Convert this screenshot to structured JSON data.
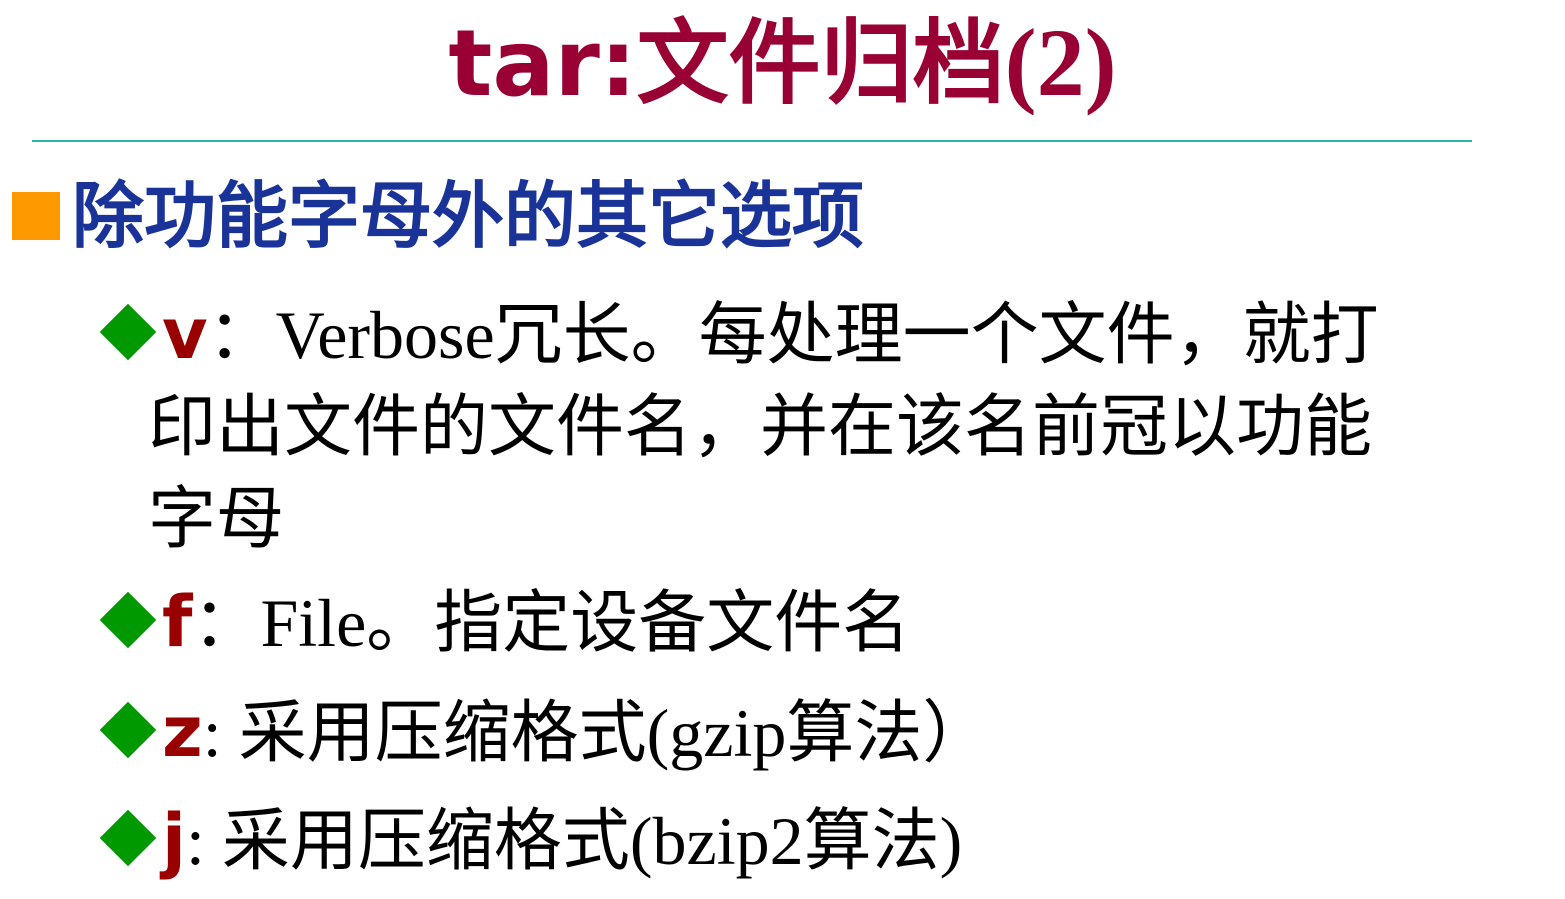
{
  "title": {
    "main": "tar:文件归档",
    "suffix": "(2)"
  },
  "heading": {
    "text": "除功能字母外的其它选项"
  },
  "items": [
    {
      "key": "v",
      "line1": "：Verbose冗长。每处理一个文件，就打",
      "line2": "印出文件的文件名，并在该名前冠以功能",
      "line3": "字母"
    },
    {
      "key": "f",
      "line1": "：File。指定设备文件名"
    },
    {
      "key": "z",
      "line1": ": 采用压缩格式(gzip算法）"
    },
    {
      "key": "j",
      "line1": ": 采用压缩格式(bzip2算法)"
    }
  ],
  "colors": {
    "title": "#990033",
    "heading": "#1a3399",
    "bullet_square": "#ff9900",
    "bullet_diamond": "#009900",
    "key": "#990000",
    "rule": "#2bb5a8"
  },
  "icons": {
    "heading_bullet": "orange-square-bullet-icon",
    "item_bullet": "green-diamond-bullet-icon"
  }
}
